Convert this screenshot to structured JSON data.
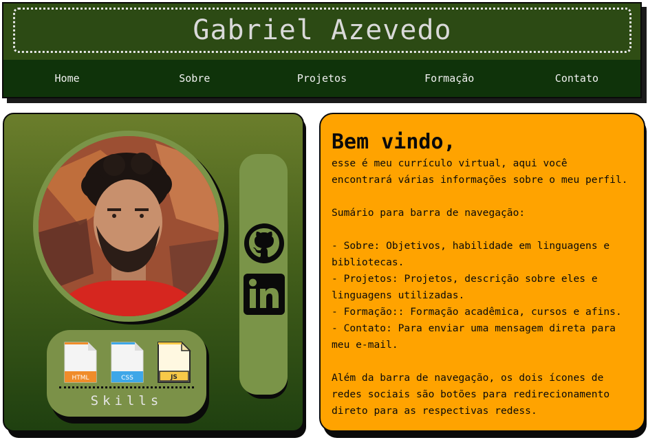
{
  "header": {
    "title": "Gabriel Azevedo",
    "nav": [
      "Home",
      "Sobre",
      "Projetos",
      "Formação",
      "Contato"
    ]
  },
  "profile": {
    "photo_icon": "profile-photo",
    "skills_label": "Skills",
    "skills": [
      {
        "name": "HTML",
        "icon": "html-file-icon",
        "color": "#e8791d"
      },
      {
        "name": "CSS",
        "icon": "css-file-icon",
        "color": "#2b9ae0"
      },
      {
        "name": "JS",
        "icon": "js-file-icon",
        "color": "#f7c948"
      }
    ],
    "social": [
      {
        "icon": "github-icon"
      },
      {
        "icon": "linkedin-icon"
      }
    ]
  },
  "intro": {
    "heading": "Bem vindo,",
    "line1": "esse é meu currículo virtual, aqui você encontrará várias informações sobre o meu perfil.",
    "summary_title": "Sumário para barra de navegação:",
    "items": [
      {
        "key": "- Sobre",
        "text": ": Objetivos, habilidade em linguagens e bibliotecas."
      },
      {
        "key": "- Projetos",
        "text": ": Projetos, descrição sobre eles e linguagens utilizadas."
      },
      {
        "key": "- Formação",
        "text": ":: Formação acadêmica, cursos e afins."
      },
      {
        "key": "- Contato",
        "text": ": Para enviar uma mensagem direta para meu e-mail."
      }
    ],
    "footer": "Além da barra de navegação, os dois ícones de redes sociais são botões para redirecionamento direto para as respectivas redess."
  },
  "colors": {
    "header_bg": "#0f330a",
    "title_bg": "#2c4a14",
    "accent_orange": "#ffa300",
    "panel_green": "#7a9448"
  }
}
